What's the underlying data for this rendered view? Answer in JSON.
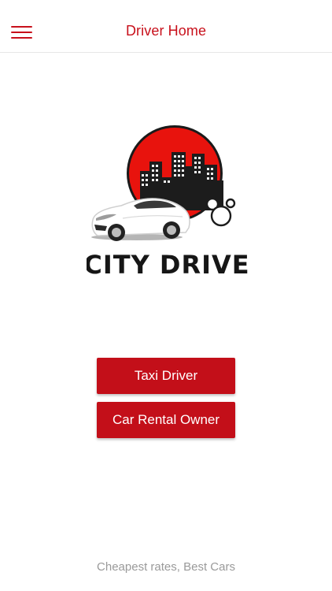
{
  "header": {
    "title": "Driver Home",
    "menu_icon": "hamburger-menu-icon"
  },
  "logo": {
    "text": "CITY DRIVE",
    "description_icon": "city-drive-logo"
  },
  "actions": {
    "taxi_driver_label": "Taxi Driver",
    "car_rental_owner_label": "Car Rental Owner"
  },
  "footer": {
    "tagline": "Cheapest rates, Best Cars"
  },
  "colors": {
    "accent": "#c8101b",
    "button_bg": "#c30f19",
    "tagline": "#9a9a9a"
  }
}
